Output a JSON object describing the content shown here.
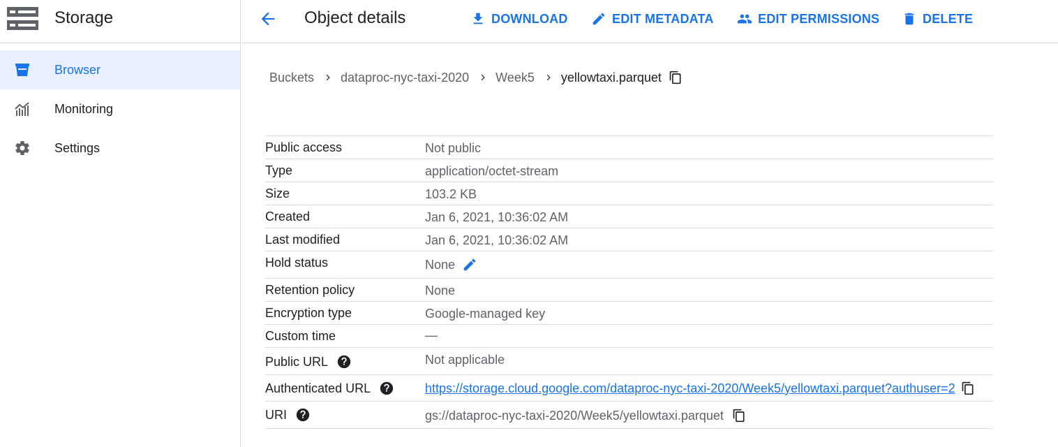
{
  "sidebar": {
    "title": "Storage",
    "items": [
      {
        "label": "Browser"
      },
      {
        "label": "Monitoring"
      },
      {
        "label": "Settings"
      }
    ]
  },
  "header": {
    "title": "Object details",
    "actions": [
      {
        "label": "DOWNLOAD"
      },
      {
        "label": "EDIT METADATA"
      },
      {
        "label": "EDIT PERMISSIONS"
      },
      {
        "label": "DELETE"
      }
    ]
  },
  "breadcrumb": [
    "Buckets",
    "dataproc-nyc-taxi-2020",
    "Week5",
    "yellowtaxi.parquet"
  ],
  "details": {
    "public_access": {
      "label": "Public access",
      "value": "Not public"
    },
    "type": {
      "label": "Type",
      "value": "application/octet-stream"
    },
    "size": {
      "label": "Size",
      "value": "103.2 KB"
    },
    "created": {
      "label": "Created",
      "value": "Jan 6, 2021, 10:36:02 AM"
    },
    "last_modified": {
      "label": "Last modified",
      "value": "Jan 6, 2021, 10:36:02 AM"
    },
    "hold_status": {
      "label": "Hold status",
      "value": "None"
    },
    "retention_policy": {
      "label": "Retention policy",
      "value": "None"
    },
    "encryption_type": {
      "label": "Encryption type",
      "value": "Google-managed key"
    },
    "custom_time": {
      "label": "Custom time",
      "value": "—"
    },
    "public_url": {
      "label": "Public URL",
      "value": "Not applicable"
    },
    "authenticated_url": {
      "label": "Authenticated URL",
      "value": "https://storage.cloud.google.com/dataproc-nyc-taxi-2020/Week5/yellowtaxi.parquet?authuser=2"
    },
    "uri": {
      "label": "URI",
      "value": "gs://dataproc-nyc-taxi-2020/Week5/yellowtaxi.parquet"
    }
  },
  "colors": {
    "accent": "#1a73e8",
    "text": "#202124",
    "secondary": "#5f6368",
    "divider": "#dadce0",
    "active_bg": "#e8f0fe"
  },
  "icons": [
    "storage-icon",
    "bucket-icon",
    "monitoring-icon",
    "gear-icon",
    "back-arrow-icon",
    "download-icon",
    "pencil-icon",
    "people-icon",
    "trash-icon",
    "chevron-right-icon",
    "copy-icon",
    "help-icon"
  ]
}
